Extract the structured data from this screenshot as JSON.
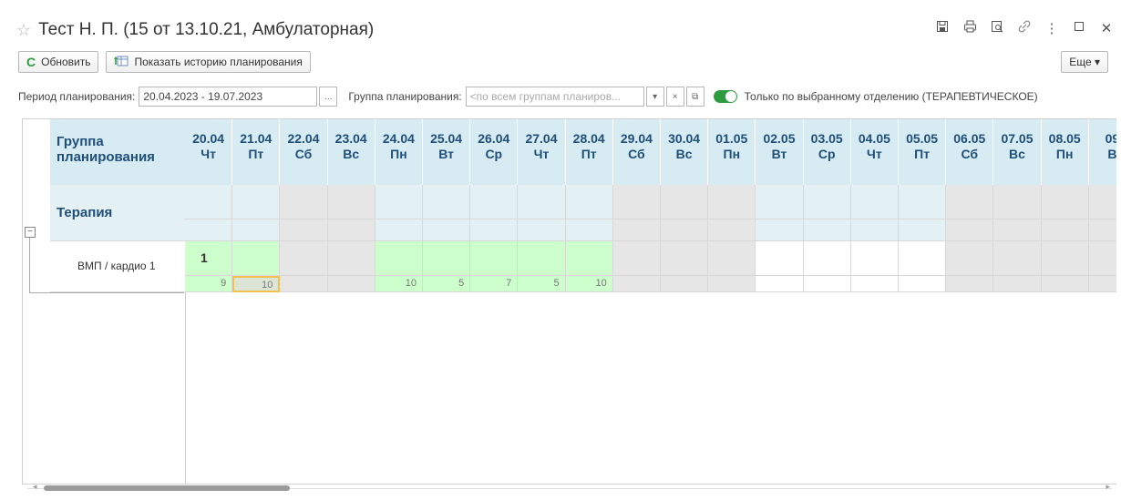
{
  "window": {
    "title": "Тест Н. П. (15 от 13.10.21, Амбулаторная)",
    "icons": [
      "save-icon",
      "print-icon",
      "preview-icon",
      "link-icon",
      "more-vert-icon",
      "maximize-icon",
      "close-icon"
    ]
  },
  "toolbar": {
    "refresh_label": "Обновить",
    "history_label": "Показать историю планирования",
    "more_label": "Еще ▾"
  },
  "filters": {
    "period_label": "Период планирования:",
    "period_value": "20.04.2023 - 19.07.2023",
    "ellipsis": "...",
    "group_label": "Группа планирования:",
    "group_placeholder": "<по всем группам планиров...",
    "dropdown_glyph": "▾",
    "clear_glyph": "×",
    "open_glyph": "⧉",
    "toggle_label": "Только по выбранному отделению (ТЕРАПЕВТИЧЕСКОЕ)"
  },
  "grid": {
    "group_header_line1": "Группа",
    "group_header_line2": "планирования",
    "section": "Терапия",
    "row_label": "ВМП / кардио 1",
    "row_count": "1",
    "days": [
      {
        "date": "20.04",
        "dow": "Чт",
        "weekend": false,
        "filled": true,
        "value": "9"
      },
      {
        "date": "21.04",
        "dow": "Пт",
        "weekend": false,
        "filled": true,
        "value": "10",
        "selected": true
      },
      {
        "date": "22.04",
        "dow": "Сб",
        "weekend": true,
        "filled": false,
        "value": ""
      },
      {
        "date": "23.04",
        "dow": "Вс",
        "weekend": true,
        "filled": false,
        "value": ""
      },
      {
        "date": "24.04",
        "dow": "Пн",
        "weekend": false,
        "filled": true,
        "value": "10"
      },
      {
        "date": "25.04",
        "dow": "Вт",
        "weekend": false,
        "filled": true,
        "value": "5"
      },
      {
        "date": "26.04",
        "dow": "Ср",
        "weekend": false,
        "filled": true,
        "value": "7"
      },
      {
        "date": "27.04",
        "dow": "Чт",
        "weekend": false,
        "filled": true,
        "value": "5"
      },
      {
        "date": "28.04",
        "dow": "Пт",
        "weekend": false,
        "filled": true,
        "value": "10"
      },
      {
        "date": "29.04",
        "dow": "Сб",
        "weekend": true,
        "filled": false,
        "value": ""
      },
      {
        "date": "30.04",
        "dow": "Вс",
        "weekend": true,
        "filled": false,
        "value": ""
      },
      {
        "date": "01.05",
        "dow": "Пн",
        "weekend": true,
        "filled": false,
        "value": ""
      },
      {
        "date": "02.05",
        "dow": "Вт",
        "weekend": false,
        "filled": false,
        "value": ""
      },
      {
        "date": "03.05",
        "dow": "Ср",
        "weekend": false,
        "filled": false,
        "value": ""
      },
      {
        "date": "04.05",
        "dow": "Чт",
        "weekend": false,
        "filled": false,
        "value": ""
      },
      {
        "date": "05.05",
        "dow": "Пт",
        "weekend": false,
        "filled": false,
        "value": ""
      },
      {
        "date": "06.05",
        "dow": "Сб",
        "weekend": true,
        "filled": false,
        "value": ""
      },
      {
        "date": "07.05",
        "dow": "Вс",
        "weekend": true,
        "filled": false,
        "value": ""
      },
      {
        "date": "08.05",
        "dow": "Пн",
        "weekend": true,
        "filled": false,
        "value": ""
      },
      {
        "date": "09",
        "dow": "В",
        "weekend": true,
        "filled": false,
        "value": ""
      }
    ]
  },
  "colors": {
    "header_bg": "#d6ecf2",
    "weekend_bg": "#e6e6e6",
    "filled_bg": "#ccffcc",
    "selected_border": "#f2c14e",
    "accent_green": "#2e9b3e"
  }
}
